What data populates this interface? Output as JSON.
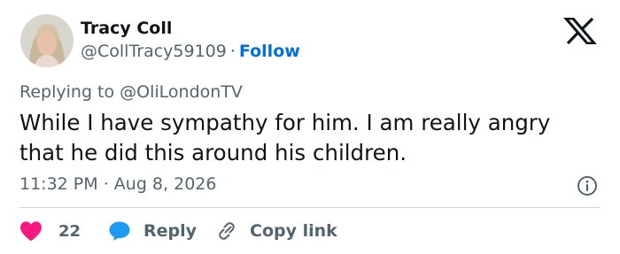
{
  "author": {
    "name": "Tracy Coll",
    "handle": "@CollTracy59109",
    "separator": "·",
    "follow_label": "Follow"
  },
  "reply_context": {
    "prefix": "Replying to",
    "mention": "@OliLondonTV"
  },
  "tweet": {
    "text": "While I have sympathy for him. I am really angry that he did this around his children.",
    "time": "11:32 PM",
    "separator": "·",
    "date": "Aug 8, 2026"
  },
  "actions": {
    "like_count": "22",
    "reply_label": "Reply",
    "copy_link_label": "Copy link"
  },
  "icons": {
    "logo": "x-logo-icon",
    "info": "info-icon",
    "like": "heart-icon",
    "reply": "speech-bubble-icon",
    "copy_link": "link-icon"
  },
  "colors": {
    "like": "#f91880",
    "reply": "#1d9bf0",
    "follow": "#006fd6",
    "muted": "#536471",
    "text": "#0f1419"
  }
}
